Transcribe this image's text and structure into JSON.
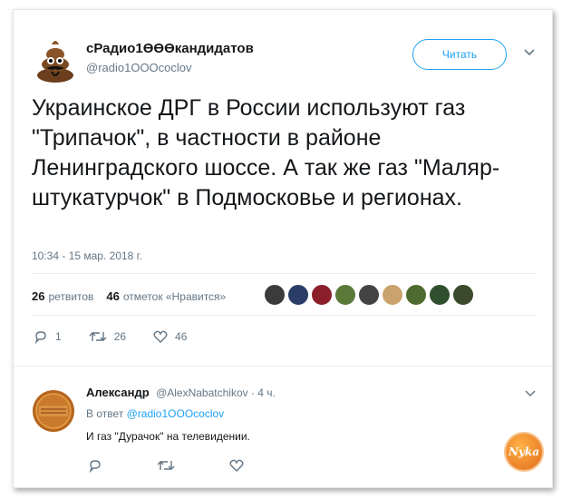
{
  "tweet": {
    "author_name": "сРадио1ӨӨӨкандидатов",
    "author_handle": "@radio1OOOcoclov",
    "follow_label": "Читать",
    "text": "Украинское ДРГ в России используют газ \"Трипачок\", в частности в районе Ленинградского шоссе. А так же газ \"Маляр-штукатурчок\" в Подмосковье и регионах.",
    "timestamp": "10:34 - 15 мар. 2018 г.",
    "retweets_count": "26",
    "retweets_label": "ретвитов",
    "likes_count": "46",
    "likes_label": "отметок «Нравится»",
    "liker_avatar_colors": [
      "#3b3b3b",
      "#2a3d66",
      "#8a1f2a",
      "#5b7a3a",
      "#444444",
      "#c9a36b",
      "#4f6a2e",
      "#2f4f2f",
      "#3a4a2a"
    ],
    "actions": {
      "reply_count": "1",
      "retweet_count": "26",
      "like_count": "46"
    }
  },
  "reply": {
    "author_name": "Александр",
    "author_handle": "@AlexNabatchikov",
    "time": "· 4 ч.",
    "reply_to_prefix": "В ответ",
    "reply_to_handle": "@radio1OOOcoclov",
    "text": "И газ \"Дурачок\" на телевидении."
  },
  "watermark": {
    "label": "Nyka"
  },
  "colors": {
    "accent": "#1da1f2",
    "muted": "#657786",
    "text": "#14171a"
  }
}
